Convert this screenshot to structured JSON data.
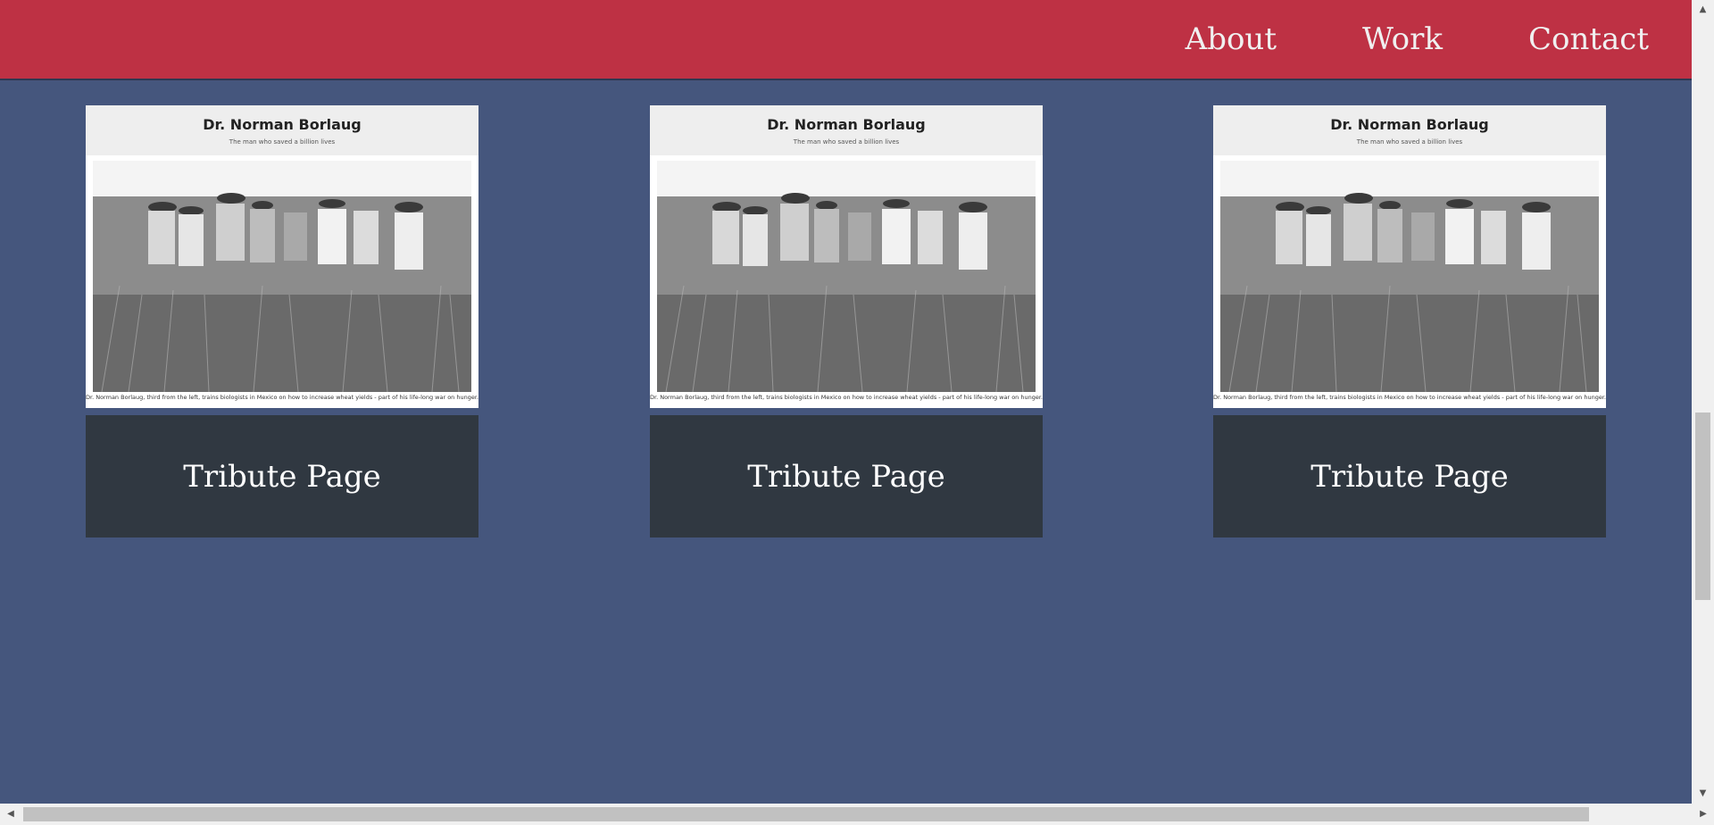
{
  "nav": {
    "items": [
      {
        "label": "About"
      },
      {
        "label": "Work"
      },
      {
        "label": "Contact"
      }
    ]
  },
  "projects": [
    {
      "thumb_title": "Dr. Norman Borlaug",
      "thumb_subtitle": "The man who saved a billion lives",
      "thumb_caption": "Dr. Norman Borlaug, third from the left, trains biologists in Mexico on how to increase wheat yields - part of his life-long war on hunger.",
      "label": "Tribute Page"
    },
    {
      "thumb_title": "Dr. Norman Borlaug",
      "thumb_subtitle": "The man who saved a billion lives",
      "thumb_caption": "Dr. Norman Borlaug, third from the left, trains biologists in Mexico on how to increase wheat yields - part of his life-long war on hunger.",
      "label": "Tribute Page"
    },
    {
      "thumb_title": "Dr. Norman Borlaug",
      "thumb_subtitle": "The man who saved a billion lives",
      "thumb_caption": "Dr. Norman Borlaug, third from the left, trains biologists in Mexico on how to increase wheat yields - part of his life-long war on hunger.",
      "label": "Tribute Page"
    }
  ],
  "colors": {
    "nav_background": "#be3144",
    "page_background": "#45567d",
    "label_background": "#303841"
  },
  "icons": {
    "scroll_up": "chevron-up-icon",
    "scroll_down": "chevron-down-icon",
    "scroll_left": "chevron-left-icon",
    "scroll_right": "chevron-right-icon"
  }
}
